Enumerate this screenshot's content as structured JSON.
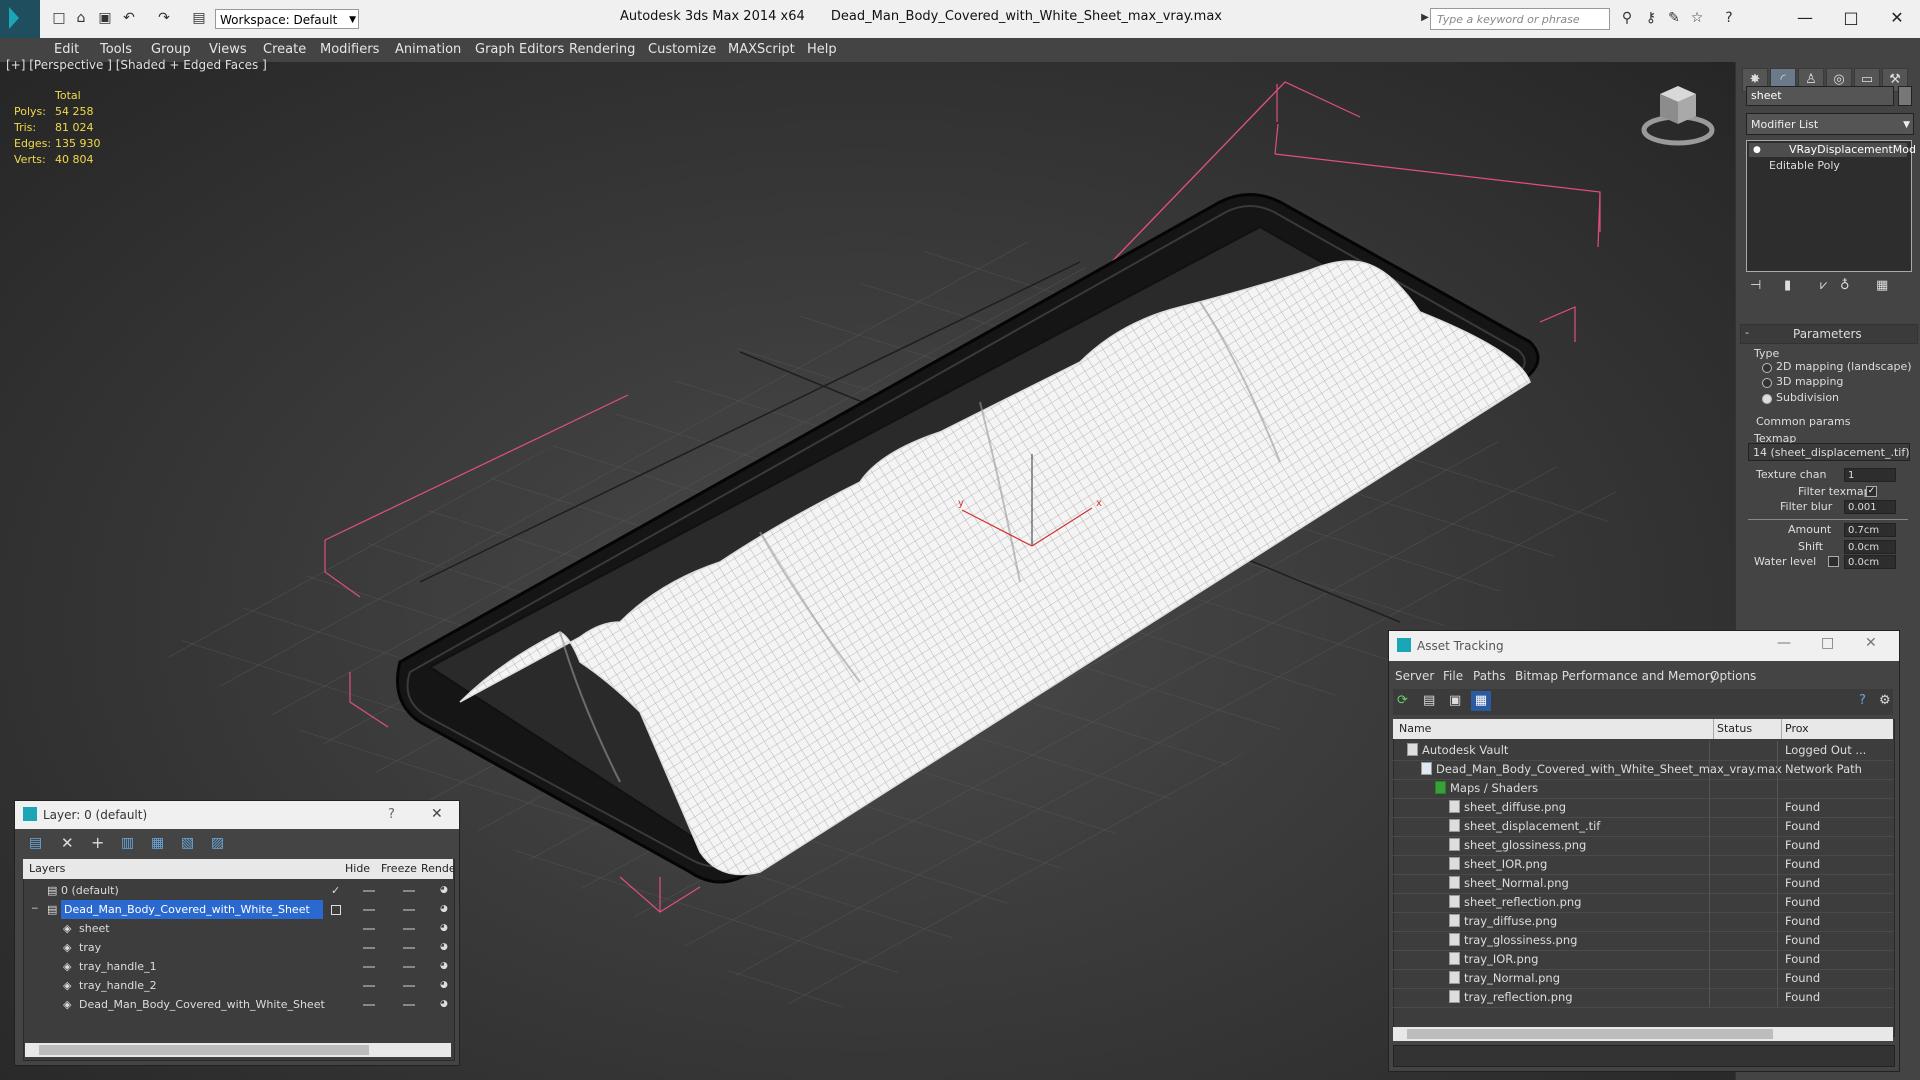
{
  "title_bar": {
    "workspace_label": "Workspace: Default",
    "app_name": "Autodesk 3ds Max  2014 x64",
    "file_title": "Dead_Man_Body_Covered_with_White_Sheet_max_vray.max",
    "search_placeholder": "Type a keyword or phrase"
  },
  "menu": [
    "Edit",
    "Tools",
    "Group",
    "Views",
    "Create",
    "Modifiers",
    "Animation",
    "Graph Editors",
    "Rendering",
    "Customize",
    "MAXScript",
    "Help"
  ],
  "viewport": {
    "label": "[+] [Perspective ] [Shaded + Edged Faces ]",
    "stats_header": "Total",
    "stats": [
      {
        "label": "Polys:",
        "value": "54 258"
      },
      {
        "label": "Tris:",
        "value": "81 024"
      },
      {
        "label": "Edges:",
        "value": "135 930"
      },
      {
        "label": "Verts:",
        "value": "40 804"
      }
    ],
    "axis_x": "x",
    "axis_y": "y"
  },
  "command_panel": {
    "object_name": "sheet",
    "modifier_list": "Modifier List",
    "stack": [
      "VRayDisplacementMod",
      "Editable Poly"
    ],
    "rollout_title": "Parameters",
    "type_label": "Type",
    "type_options": [
      "2D mapping (landscape)",
      "3D mapping",
      "Subdivision"
    ],
    "common_params": "Common params",
    "texmap_label": "Texmap",
    "texmap_value": "14 (sheet_displacement_.tif)",
    "texture_chan_label": "Texture chan",
    "texture_chan_value": "1",
    "filter_texmap_label": "Filter texmap",
    "filter_blur_label": "Filter blur",
    "filter_blur_value": "0.001",
    "amount_label": "Amount",
    "amount_value": "0.7cm",
    "shift_label": "Shift",
    "shift_value": "0.0cm",
    "water_level_label": "Water level",
    "water_level_value": "0.0cm"
  },
  "layer_dialog": {
    "title": "Layer: 0 (default)",
    "help": "?",
    "columns": [
      "Layers",
      "Hide",
      "Freeze",
      "Rende"
    ],
    "rows": [
      {
        "name": "0 (default)",
        "indent": 0
      },
      {
        "name": "Dead_Man_Body_Covered_with_White_Sheet",
        "indent": 0
      },
      {
        "name": "sheet",
        "indent": 1
      },
      {
        "name": "tray",
        "indent": 1
      },
      {
        "name": "tray_handle_1",
        "indent": 1
      },
      {
        "name": "tray_handle_2",
        "indent": 1
      },
      {
        "name": "Dead_Man_Body_Covered_with_White_Sheet",
        "indent": 1
      }
    ]
  },
  "asset_dialog": {
    "title": "Asset Tracking",
    "menu": [
      "Server",
      "File",
      "Paths",
      "Bitmap Performance and Memory",
      "Options"
    ],
    "columns": [
      "Name",
      "Status",
      "Prox"
    ],
    "rows": [
      {
        "name": "Autodesk Vault",
        "status": "Logged Out ...",
        "indent": 1
      },
      {
        "name": "Dead_Man_Body_Covered_with_White_Sheet_max_vray.max",
        "status": "Network Path",
        "indent": 2
      },
      {
        "name": "Maps / Shaders",
        "status": "",
        "indent": 3
      },
      {
        "name": "sheet_diffuse.png",
        "status": "Found",
        "indent": 4
      },
      {
        "name": "sheet_displacement_.tif",
        "status": "Found",
        "indent": 4
      },
      {
        "name": "sheet_glossiness.png",
        "status": "Found",
        "indent": 4
      },
      {
        "name": "sheet_IOR.png",
        "status": "Found",
        "indent": 4
      },
      {
        "name": "sheet_Normal.png",
        "status": "Found",
        "indent": 4
      },
      {
        "name": "sheet_reflection.png",
        "status": "Found",
        "indent": 4
      },
      {
        "name": "tray_diffuse.png",
        "status": "Found",
        "indent": 4
      },
      {
        "name": "tray_glossiness.png",
        "status": "Found",
        "indent": 4
      },
      {
        "name": "tray_IOR.png",
        "status": "Found",
        "indent": 4
      },
      {
        "name": "tray_Normal.png",
        "status": "Found",
        "indent": 4
      },
      {
        "name": "tray_reflection.png",
        "status": "Found",
        "indent": 4
      }
    ]
  },
  "colors": {
    "stats_text": "#f2d94a",
    "bbox_lines": "#e0507a",
    "selection": "#2a6ad0",
    "wire": "#ffffff"
  }
}
